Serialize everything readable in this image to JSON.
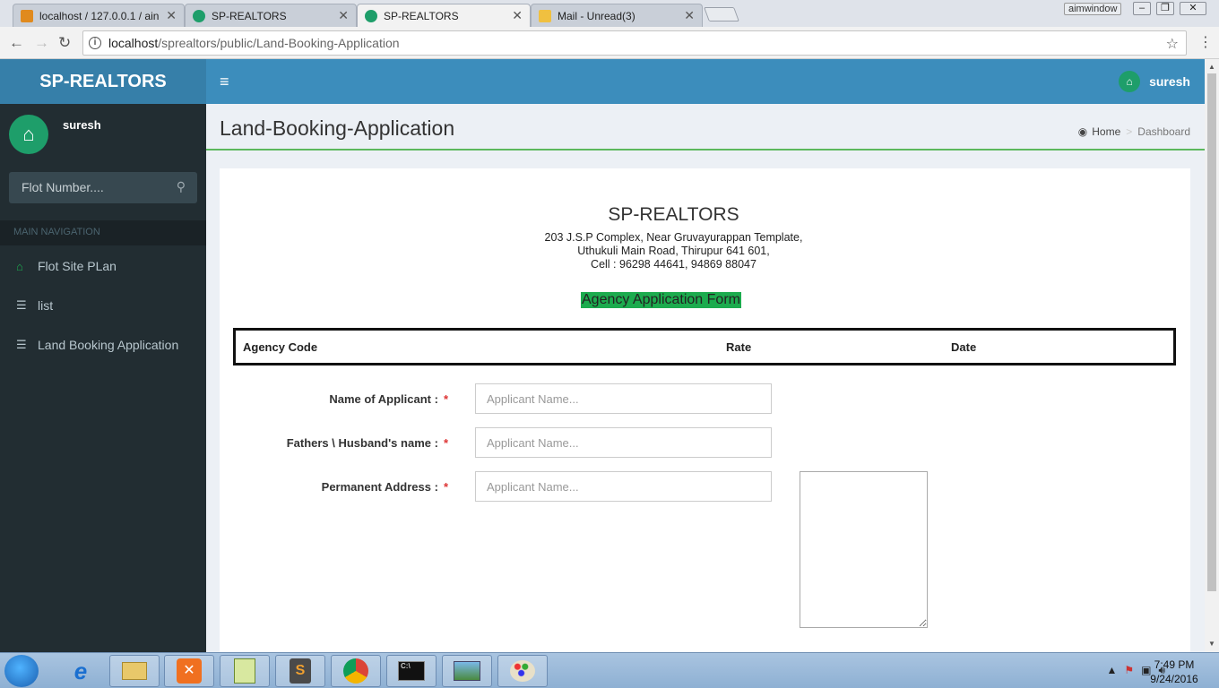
{
  "browser": {
    "tabs": [
      {
        "title": "localhost / 127.0.0.1 / ain",
        "favicon": "phpmyadmin-icon",
        "active": false
      },
      {
        "title": "SP-REALTORS",
        "favicon": "home-icon",
        "active": false
      },
      {
        "title": "SP-REALTORS",
        "favicon": "home-icon",
        "active": true
      },
      {
        "title": "Mail - Unread(3)",
        "favicon": "mail-icon",
        "active": false
      }
    ],
    "window_label": "aimwindow",
    "url_host": "localhost",
    "url_path": "/sprealtors/public/Land-Booking-Application"
  },
  "header": {
    "brand": "SP-REALTORS",
    "user": "suresh"
  },
  "sidebar": {
    "user": "suresh",
    "search_placeholder": "Flot Number....",
    "nav_header": "MAIN NAVIGATION",
    "items": [
      {
        "label": "Flot Site PLan",
        "icon": "home-icon"
      },
      {
        "label": "list",
        "icon": "list-icon"
      },
      {
        "label": "Land Booking Application",
        "icon": "list-icon"
      }
    ]
  },
  "page": {
    "title": "Land-Booking-Application",
    "breadcrumb": {
      "home": "Home",
      "current": "Dashboard"
    }
  },
  "form": {
    "company": "SP-REALTORS",
    "address_lines": [
      "203 J.S.P Complex, Near Gruvayurappan Template,",
      "Uthukuli Main Road, Thirupur 641 601,",
      "Cell : 96298 44641, 94869 88047"
    ],
    "form_title": "Agency Application Form",
    "code_bar": {
      "agency_code": "Agency Code",
      "rate": "Rate",
      "date": "Date"
    },
    "fields": [
      {
        "label": "Name of Applicant :",
        "required": "*",
        "placeholder": "Applicant Name..."
      },
      {
        "label": "Fathers \\ Husband's name :",
        "required": "*",
        "placeholder": "Applicant Name..."
      },
      {
        "label": "Permanent Address :",
        "required": "*",
        "placeholder": "Applicant Name..."
      }
    ]
  },
  "taskbar": {
    "time": "7:49 PM",
    "date": "9/24/2016"
  },
  "colors": {
    "header_blue": "#3c8dbc",
    "logo_blue": "#367fa9",
    "sidebar_dark": "#222d32",
    "accent_green": "#1cab4e",
    "avatar_green": "#1e9e6a"
  }
}
